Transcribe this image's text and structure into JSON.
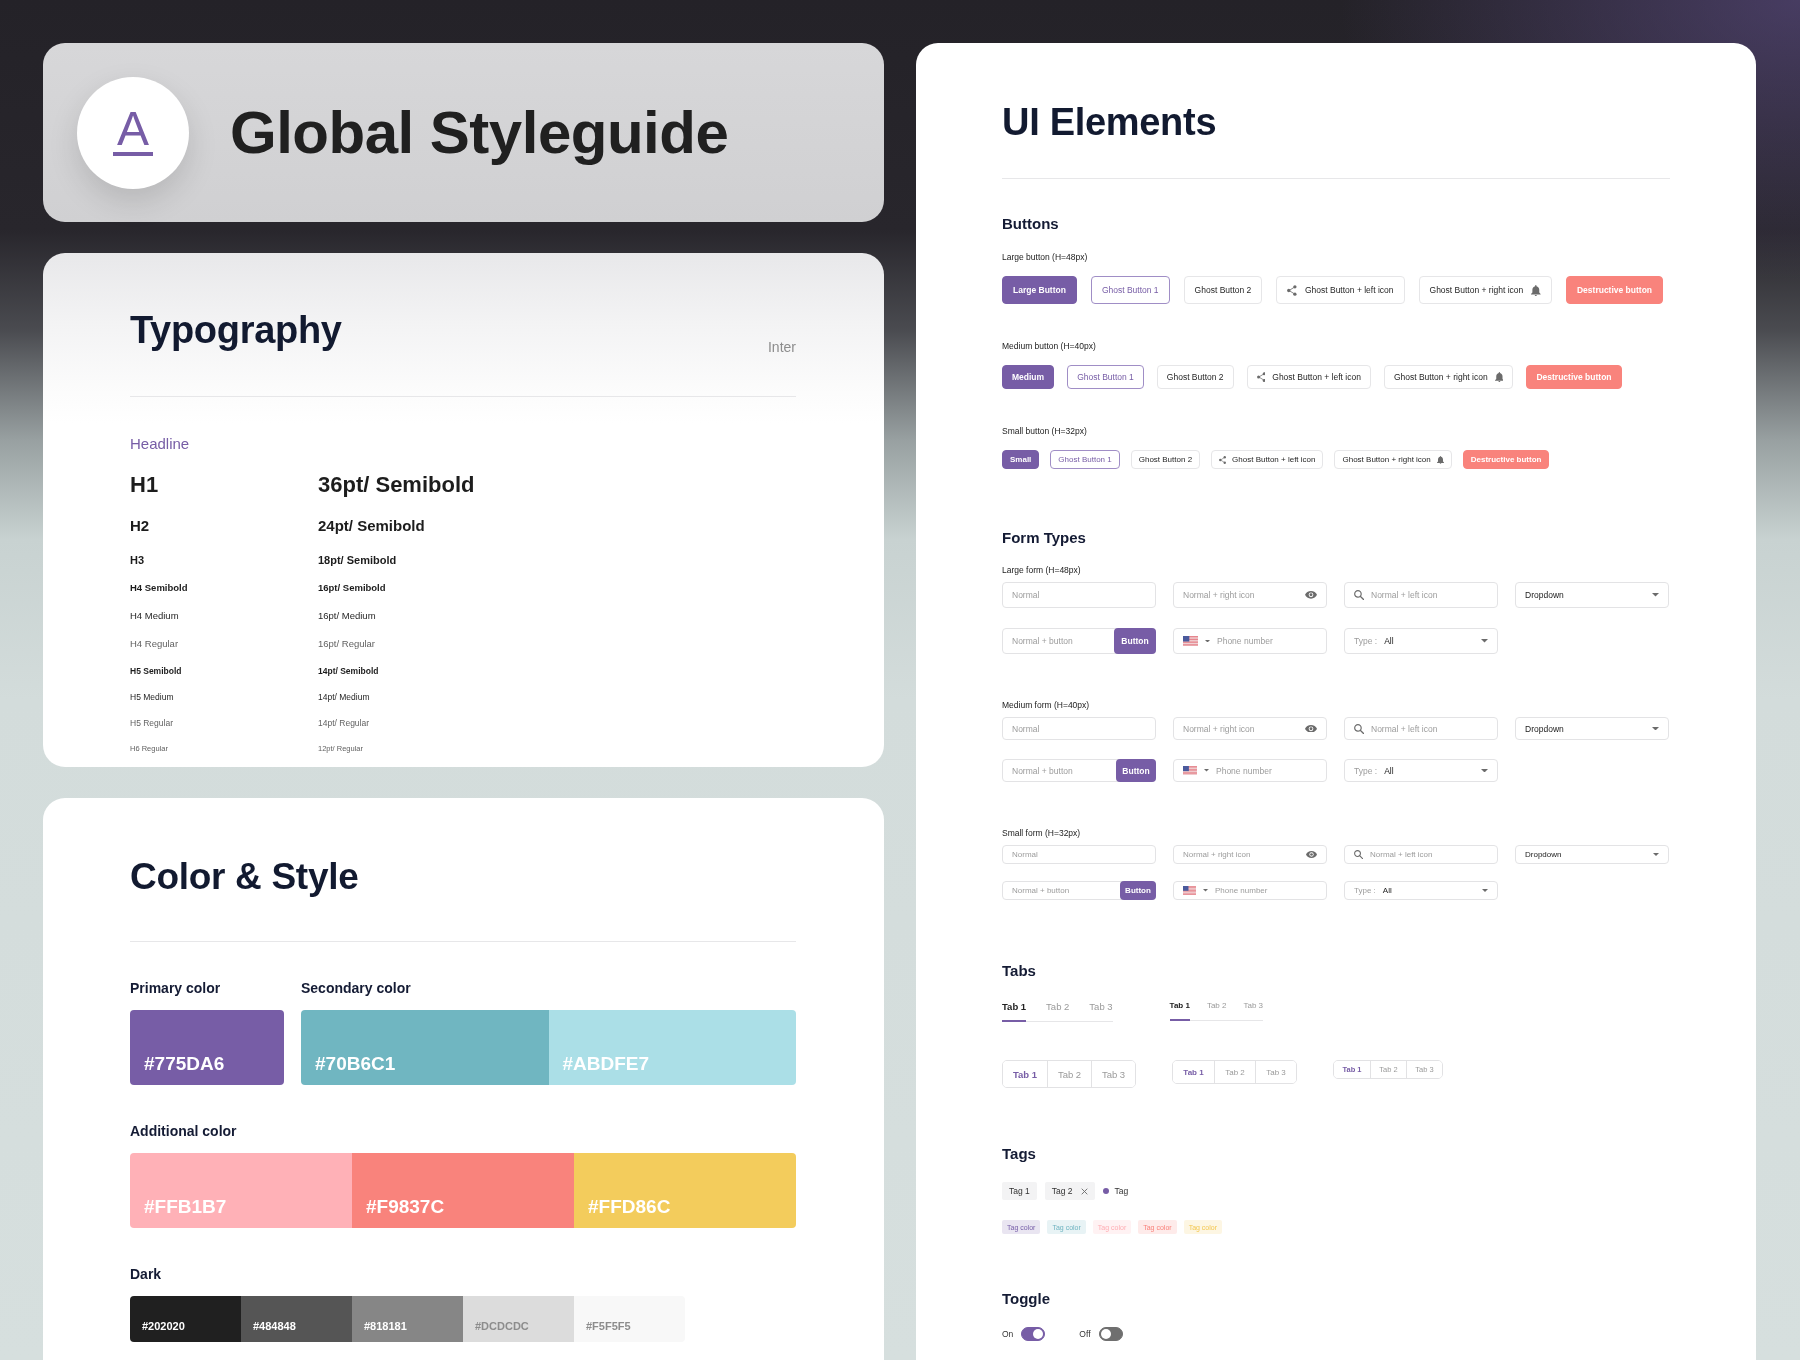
{
  "header": {
    "logo_letter": "A",
    "title": "Global Styleguide"
  },
  "typography": {
    "title": "Typography",
    "font": "Inter",
    "category": "Headline",
    "styles": [
      {
        "kind": "h1",
        "name": "H1",
        "spec": "36pt/ Semibold"
      },
      {
        "kind": "h2",
        "name": "H2",
        "spec": "24pt/ Semibold"
      },
      {
        "kind": "h3",
        "name": "H3",
        "spec": "18pt/ Semibold"
      },
      {
        "kind": "h4-semibold",
        "name": "H4 Semibold",
        "spec": "16pt/ Semibold"
      },
      {
        "kind": "h4-medium",
        "name": "H4 Medium",
        "spec": "16pt/ Medium"
      },
      {
        "kind": "h4-regular",
        "name": "H4 Regular",
        "spec": "16pt/ Regular"
      },
      {
        "kind": "h5-semibold",
        "name": "H5 Semibold",
        "spec": "14pt/ Semibold"
      },
      {
        "kind": "h5-medium",
        "name": "H5 Medium",
        "spec": "14pt/ Medium"
      },
      {
        "kind": "h5-regular",
        "name": "H5 Regular",
        "spec": "14pt/ Regular"
      },
      {
        "kind": "h6-regular",
        "name": "H6 Regular",
        "spec": "12pt/ Regular"
      }
    ]
  },
  "colors": {
    "title": "Color & Style",
    "rows": [
      {
        "palettes": [
          {
            "kind": "large",
            "label": "Primary color",
            "swatches": [
              {
                "hex": "#775DA6",
                "color": "#775da6"
              }
            ]
          },
          {
            "kind": "large",
            "label": "Secondary color",
            "swatches": [
              {
                "hex": "#70B6C1",
                "color": "#70b6c1"
              },
              {
                "hex": "#ABDFE7",
                "color": "#abdfe7"
              }
            ]
          }
        ]
      },
      {
        "palettes": [
          {
            "kind": "large",
            "label": "Additional color",
            "swatches": [
              {
                "hex": "#FFB1B7",
                "color": "#ffb1b7"
              },
              {
                "hex": "#F9837C",
                "color": "#f9837c"
              },
              {
                "hex": "#FFD86C",
                "color": "#f3cc5c"
              }
            ]
          }
        ]
      },
      {
        "palettes": [
          {
            "kind": "small",
            "label": "Dark",
            "swatches": [
              {
                "hex": "#202020",
                "color": "#202020"
              },
              {
                "hex": "#484848",
                "color": "#555555"
              },
              {
                "hex": "#818181",
                "color": "#868686"
              },
              {
                "hex": "#DCDCDC",
                "color": "#dcdcdc"
              },
              {
                "hex": "#F5F5F5",
                "color": "#f8f8f8"
              }
            ]
          }
        ]
      }
    ]
  },
  "ui": {
    "title": "UI Elements",
    "buttons": {
      "title": "Buttons",
      "groups": [
        {
          "kind": "large",
          "label": "Large button (H=48px)",
          "items": [
            {
              "kind": "primary",
              "label": "Large Button"
            },
            {
              "kind": "outline",
              "label": "Ghost Button 1"
            },
            {
              "kind": "ghost",
              "label": "Ghost Button 2"
            },
            {
              "kind": "icon-left",
              "label": "Ghost Button + left icon"
            },
            {
              "kind": "icon-right",
              "label": "Ghost Button + right icon"
            },
            {
              "kind": "destructive",
              "label": "Destructive button"
            }
          ]
        },
        {
          "kind": "medium",
          "label": "Medium button (H=40px)",
          "items": [
            {
              "kind": "primary",
              "label": "Medium"
            },
            {
              "kind": "outline",
              "label": "Ghost Button 1"
            },
            {
              "kind": "ghost",
              "label": "Ghost Button 2"
            },
            {
              "kind": "icon-left",
              "label": "Ghost Button + left icon"
            },
            {
              "kind": "icon-right",
              "label": "Ghost Button + right icon"
            },
            {
              "kind": "destructive",
              "label": "Destructive button"
            }
          ]
        },
        {
          "kind": "small",
          "label": "Small button (H=32px)",
          "items": [
            {
              "kind": "primary",
              "label": "Small"
            },
            {
              "kind": "outline",
              "label": "Ghost Button 1"
            },
            {
              "kind": "ghost",
              "label": "Ghost Button 2"
            },
            {
              "kind": "icon-left",
              "label": "Ghost Button + left icon"
            },
            {
              "kind": "icon-right",
              "label": "Ghost Button + right icon"
            },
            {
              "kind": "destructive",
              "label": "Destructive button"
            }
          ]
        }
      ]
    },
    "forms": {
      "title": "Form Types",
      "groups": [
        {
          "kind": "large",
          "label": "Large form (H=48px)",
          "rows": [
            {
              "fields": [
                {
                  "kind": "text",
                  "placeholder": "Normal"
                },
                {
                  "kind": "icon-right",
                  "placeholder": "Normal + right icon"
                },
                {
                  "kind": "icon-left",
                  "placeholder": "Normal + left icon"
                },
                {
                  "kind": "dropdown",
                  "value": "Dropdown"
                }
              ]
            },
            {
              "fields": [
                {
                  "kind": "with-button",
                  "placeholder": "Normal + button",
                  "button": "Button"
                },
                {
                  "kind": "phone",
                  "placeholder": "Phone number"
                },
                {
                  "kind": "select",
                  "label": "Type :",
                  "value": "All"
                }
              ]
            }
          ]
        },
        {
          "kind": "medium",
          "label": "Medium form (H=40px)",
          "rows": [
            {
              "fields": [
                {
                  "kind": "text",
                  "placeholder": "Normal"
                },
                {
                  "kind": "icon-right",
                  "placeholder": "Normal + right icon"
                },
                {
                  "kind": "icon-left",
                  "placeholder": "Normal + left icon"
                },
                {
                  "kind": "dropdown",
                  "value": "Dropdown"
                }
              ]
            },
            {
              "fields": [
                {
                  "kind": "with-button",
                  "placeholder": "Normal + button",
                  "button": "Button"
                },
                {
                  "kind": "phone",
                  "placeholder": "Phone number"
                },
                {
                  "kind": "select",
                  "label": "Type :",
                  "value": "All"
                }
              ]
            }
          ]
        },
        {
          "kind": "small",
          "label": "Small form (H=32px)",
          "rows": [
            {
              "fields": [
                {
                  "kind": "text",
                  "placeholder": "Normal"
                },
                {
                  "kind": "icon-right",
                  "placeholder": "Normal + right icon"
                },
                {
                  "kind": "icon-left",
                  "placeholder": "Normal + left icon"
                },
                {
                  "kind": "dropdown",
                  "value": "Dropdown"
                }
              ]
            },
            {
              "fields": [
                {
                  "kind": "with-button",
                  "placeholder": "Normal + button",
                  "button": "Button"
                },
                {
                  "kind": "phone",
                  "placeholder": "Phone number"
                },
                {
                  "kind": "select",
                  "label": "Type :",
                  "value": "All"
                }
              ]
            }
          ]
        }
      ]
    },
    "tabs": {
      "title": "Tabs",
      "rows": [
        {
          "kind": "underline",
          "groups": [
            {
              "kind": "large",
              "tabs": [
                {
                  "label": "Tab 1",
                  "selected": true
                },
                {
                  "label": "Tab 2",
                  "selected": false
                },
                {
                  "label": "Tab 3",
                  "selected": false
                }
              ]
            },
            {
              "kind": "medium",
              "tabs": [
                {
                  "label": "Tab 1",
                  "selected": true
                },
                {
                  "label": "Tab 2",
                  "selected": false
                },
                {
                  "label": "Tab 3",
                  "selected": false
                }
              ]
            }
          ]
        },
        {
          "kind": "segmented",
          "groups": [
            {
              "kind": "large",
              "tabs": [
                {
                  "label": "Tab 1",
                  "selected": true
                },
                {
                  "label": "Tab 2",
                  "selected": false
                },
                {
                  "label": "Tab 3",
                  "selected": false
                }
              ]
            },
            {
              "kind": "medium",
              "tabs": [
                {
                  "label": "Tab 1",
                  "selected": true
                },
                {
                  "label": "Tab 2",
                  "selected": false
                },
                {
                  "label": "Tab 3",
                  "selected": false
                }
              ]
            },
            {
              "kind": "small",
              "tabs": [
                {
                  "label": "Tab 1",
                  "selected": true
                },
                {
                  "label": "Tab 2",
                  "selected": false
                },
                {
                  "label": "Tab 3",
                  "selected": false
                }
              ]
            }
          ]
        }
      ]
    },
    "tags": {
      "title": "Tags",
      "rows": [
        {
          "items": [
            {
              "kind": "plain",
              "label": "Tag 1"
            },
            {
              "kind": "removable",
              "label": "Tag 2"
            },
            {
              "kind": "dot",
              "label": "Tag",
              "color": "#775da6"
            }
          ]
        },
        {
          "items": [
            {
              "kind": "tinted",
              "label": "Tag color",
              "color": "#e9e5f1"
            },
            {
              "kind": "tinted",
              "label": "Tag color",
              "color": "#e8f3f5"
            },
            {
              "kind": "tinted",
              "label": "Tag color",
              "color": "#fff2f3"
            },
            {
              "kind": "tinted",
              "label": "Tag color",
              "color": "#feebea"
            },
            {
              "kind": "tinted",
              "label": "Tag color",
              "color": "#fdf6e3"
            }
          ]
        }
      ]
    },
    "toggle": {
      "title": "Toggle",
      "items": [
        {
          "label": "On",
          "on": true
        },
        {
          "label": "Off",
          "on": false
        }
      ]
    }
  }
}
